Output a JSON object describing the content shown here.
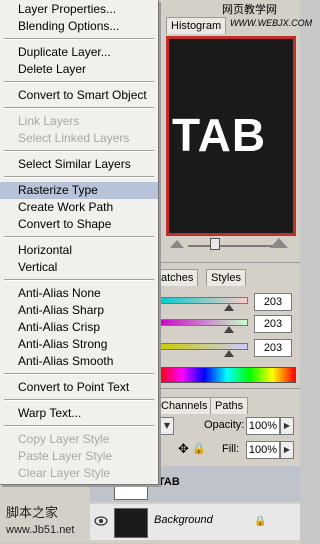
{
  "background": {
    "navigator_tabs": [
      "Histogram"
    ],
    "canvas_text": "TAB",
    "watermark_top": "网页教学网",
    "watermark_top_url": "WWW.WEBJX.COM",
    "color_tabs": [
      "atches",
      "Styles"
    ],
    "color_values": [
      "203",
      "203",
      "203"
    ],
    "layers_tabs": [
      "Channels",
      "Paths"
    ],
    "opacity_label": "Opacity:",
    "opacity_value": "100%",
    "fill_label": "Fill:",
    "fill_value": "100%",
    "layers": [
      {
        "name": "TAB"
      },
      {
        "name": "Background"
      }
    ],
    "footer_watermark": "脚本之家",
    "footer_url": "www.Jb51.net"
  },
  "menu": {
    "items": [
      {
        "label": "Layer Properties...",
        "enabled": true
      },
      {
        "label": "Blending Options...",
        "enabled": true
      },
      {
        "label": "Duplicate Layer...",
        "enabled": true
      },
      {
        "label": "Delete Layer",
        "enabled": true
      },
      {
        "label": "Convert to Smart Object",
        "enabled": true
      },
      {
        "label": "Link Layers",
        "enabled": false
      },
      {
        "label": "Select Linked Layers",
        "enabled": false
      },
      {
        "label": "Select Similar Layers",
        "enabled": true
      },
      {
        "label": "Rasterize Type",
        "enabled": true,
        "highlighted": true
      },
      {
        "label": "Create Work Path",
        "enabled": true
      },
      {
        "label": "Convert to Shape",
        "enabled": true
      },
      {
        "label": "Horizontal",
        "enabled": true
      },
      {
        "label": "Vertical",
        "enabled": true
      },
      {
        "label": "Anti-Alias None",
        "enabled": true
      },
      {
        "label": "Anti-Alias Sharp",
        "enabled": true
      },
      {
        "label": "Anti-Alias Crisp",
        "enabled": true
      },
      {
        "label": "Anti-Alias Strong",
        "enabled": true
      },
      {
        "label": "Anti-Alias Smooth",
        "enabled": true
      },
      {
        "label": "Convert to Point Text",
        "enabled": true
      },
      {
        "label": "Warp Text...",
        "enabled": true
      },
      {
        "label": "Copy Layer Style",
        "enabled": false
      },
      {
        "label": "Paste Layer Style",
        "enabled": false
      },
      {
        "label": "Clear Layer Style",
        "enabled": false
      }
    ]
  },
  "colors": {
    "highlight": "#b7c3d8",
    "canvas_border": "#c0302a",
    "canvas_bg": "#1a1a1a"
  }
}
